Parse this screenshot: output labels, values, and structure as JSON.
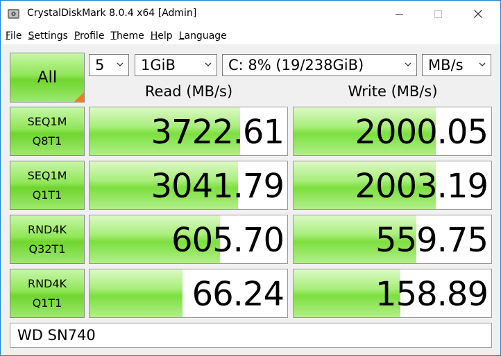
{
  "window": {
    "title": "CrystalDiskMark 8.0.4 x64 [Admin]"
  },
  "menu": [
    {
      "label": "File",
      "mnemonic": "F",
      "rest": "ile"
    },
    {
      "label": "Settings",
      "mnemonic": "S",
      "rest": "ettings"
    },
    {
      "label": "Profile",
      "mnemonic": "P",
      "rest": "rofile"
    },
    {
      "label": "Theme",
      "mnemonic": "T",
      "rest": "heme"
    },
    {
      "label": "Help",
      "mnemonic": "H",
      "rest": "elp"
    },
    {
      "label": "Language",
      "mnemonic": "L",
      "rest": "anguage"
    }
  ],
  "controls": {
    "all_label": "All",
    "count": "5",
    "size": "1GiB",
    "drive": "C: 8% (19/238GiB)",
    "unit": "MB/s"
  },
  "headers": {
    "read": "Read (MB/s)",
    "write": "Write (MB/s)"
  },
  "tests": [
    {
      "line1": "SEQ1M",
      "line2": "Q8T1",
      "read": "3722.61",
      "write": "2000.05",
      "read_fill": 0.76,
      "write_fill": 0.72
    },
    {
      "line1": "SEQ1M",
      "line2": "Q1T1",
      "read": "3041.79",
      "write": "2003.19",
      "read_fill": 0.75,
      "write_fill": 0.72
    },
    {
      "line1": "RND4K",
      "line2": "Q32T1",
      "read": "605.70",
      "write": "559.75",
      "read_fill": 0.66,
      "write_fill": 0.62
    },
    {
      "line1": "RND4K",
      "line2": "Q1T1",
      "read": "66.24",
      "write": "158.89",
      "read_fill": 0.47,
      "write_fill": 0.54
    }
  ],
  "comment": "WD SN740",
  "colors": {
    "accent_green": "#7ddf3f",
    "corner_orange": "#f47c20",
    "frame_blue": "#1883d7"
  }
}
